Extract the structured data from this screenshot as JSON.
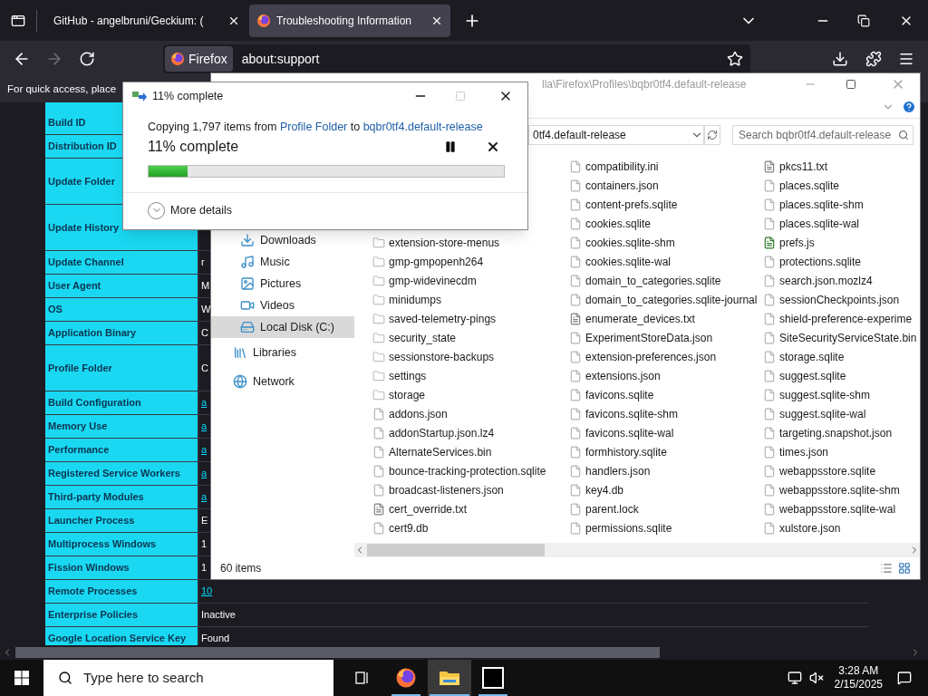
{
  "browser": {
    "tabs": [
      {
        "label": "GitHub - angelbruni/Geckium: (",
        "selected": false
      },
      {
        "label": "Troubleshooting Information",
        "selected": true
      }
    ],
    "identity": "Firefox",
    "url": "about:support",
    "toolbar_hint": "For quick access, place"
  },
  "table": {
    "rows": [
      {
        "label": "Build ID"
      },
      {
        "label": "Distribution ID"
      },
      {
        "label": "Update Folder",
        "tall": true
      },
      {
        "label": "Update History",
        "tall": true
      },
      {
        "label": "Update Channel",
        "value": "r",
        "link": false
      },
      {
        "label": "User Agent",
        "value": "M",
        "link": false
      },
      {
        "label": "OS",
        "value": "W",
        "link": false
      },
      {
        "label": "Application Binary",
        "value": "C",
        "link": false
      },
      {
        "label": "Profile Folder",
        "tall": true,
        "value": "C",
        "link": false
      },
      {
        "label": "Build Configuration",
        "value": "a",
        "link": true
      },
      {
        "label": "Memory Use",
        "value": "a",
        "link": true
      },
      {
        "label": "Performance",
        "value": "a",
        "link": true
      },
      {
        "label": "Registered Service Workers",
        "value": "a",
        "link": true
      },
      {
        "label": "Third-party Modules",
        "value": "a",
        "link": true
      },
      {
        "label": "Launcher Process",
        "value": "E",
        "link": false
      },
      {
        "label": "Multiprocess Windows",
        "value": "1",
        "link": false
      },
      {
        "label": "Fission Windows",
        "value": "1",
        "link": false
      },
      {
        "label": "Remote Processes",
        "value": "10",
        "link": true
      },
      {
        "label": "Enterprise Policies",
        "value": "Inactive",
        "link": false
      },
      {
        "label": "Google Location Service Key",
        "value": "Found",
        "link": false
      }
    ]
  },
  "explorer": {
    "title_path": "lla\\Firefox\\Profiles\\bqbr0tf4.default-release",
    "address": "0tf4.default-release",
    "search": {
      "placeholder": "Search bqbr0tf4.default-release"
    },
    "nav": [
      {
        "label": "Downloads",
        "kind": "downloads",
        "selected": false
      },
      {
        "label": "Music",
        "kind": "music",
        "selected": false
      },
      {
        "label": "Pictures",
        "kind": "pictures",
        "selected": false
      },
      {
        "label": "Videos",
        "kind": "videos",
        "selected": false
      },
      {
        "label": "Local Disk (C:)",
        "kind": "disk",
        "selected": true
      },
      {
        "label": "Libraries",
        "kind": "libraries",
        "selected": false
      },
      {
        "label": "Network",
        "kind": "network",
        "selected": false
      }
    ],
    "columns": [
      [
        {
          "name": "extension-store-menus",
          "kind": "folder"
        },
        {
          "name": "gmp-gmpopenh264",
          "kind": "folder"
        },
        {
          "name": "gmp-widevinecdm",
          "kind": "folder"
        },
        {
          "name": "minidumps",
          "kind": "folder"
        },
        {
          "name": "saved-telemetry-pings",
          "kind": "folder"
        },
        {
          "name": "security_state",
          "kind": "folder"
        },
        {
          "name": "sessionstore-backups",
          "kind": "folder"
        },
        {
          "name": "settings",
          "kind": "folder"
        },
        {
          "name": "storage",
          "kind": "folder"
        },
        {
          "name": "addons.json",
          "kind": "file"
        },
        {
          "name": "addonStartup.json.lz4",
          "kind": "file"
        },
        {
          "name": "AlternateServices.bin",
          "kind": "file"
        },
        {
          "name": "bounce-tracking-protection.sqlite",
          "kind": "file"
        },
        {
          "name": "broadcast-listeners.json",
          "kind": "file"
        },
        {
          "name": "cert_override.txt",
          "kind": "text"
        },
        {
          "name": "cert9.db",
          "kind": "file"
        }
      ],
      [
        {
          "name": "compatibility.ini",
          "kind": "file"
        },
        {
          "name": "containers.json",
          "kind": "file"
        },
        {
          "name": "content-prefs.sqlite",
          "kind": "file"
        },
        {
          "name": "cookies.sqlite",
          "kind": "file"
        },
        {
          "name": "cookies.sqlite-shm",
          "kind": "file"
        },
        {
          "name": "cookies.sqlite-wal",
          "kind": "file"
        },
        {
          "name": "domain_to_categories.sqlite",
          "kind": "file"
        },
        {
          "name": "domain_to_categories.sqlite-journal",
          "kind": "file"
        },
        {
          "name": "enumerate_devices.txt",
          "kind": "text"
        },
        {
          "name": "ExperimentStoreData.json",
          "kind": "file"
        },
        {
          "name": "extension-preferences.json",
          "kind": "file"
        },
        {
          "name": "extensions.json",
          "kind": "file"
        },
        {
          "name": "favicons.sqlite",
          "kind": "file"
        },
        {
          "name": "favicons.sqlite-shm",
          "kind": "file"
        },
        {
          "name": "favicons.sqlite-wal",
          "kind": "file"
        },
        {
          "name": "formhistory.sqlite",
          "kind": "file"
        },
        {
          "name": "handlers.json",
          "kind": "file"
        },
        {
          "name": "key4.db",
          "kind": "file"
        },
        {
          "name": "parent.lock",
          "kind": "file"
        },
        {
          "name": "permissions.sqlite",
          "kind": "file"
        }
      ],
      [
        {
          "name": "pkcs11.txt",
          "kind": "text"
        },
        {
          "name": "places.sqlite",
          "kind": "file"
        },
        {
          "name": "places.sqlite-shm",
          "kind": "file"
        },
        {
          "name": "places.sqlite-wal",
          "kind": "file"
        },
        {
          "name": "prefs.js",
          "kind": "script"
        },
        {
          "name": "protections.sqlite",
          "kind": "file"
        },
        {
          "name": "search.json.mozlz4",
          "kind": "file"
        },
        {
          "name": "sessionCheckpoints.json",
          "kind": "file"
        },
        {
          "name": "shield-preference-experime",
          "kind": "file"
        },
        {
          "name": "SiteSecurityServiceState.bin",
          "kind": "file"
        },
        {
          "name": "storage.sqlite",
          "kind": "file"
        },
        {
          "name": "suggest.sqlite",
          "kind": "file"
        },
        {
          "name": "suggest.sqlite-shm",
          "kind": "file"
        },
        {
          "name": "suggest.sqlite-wal",
          "kind": "file"
        },
        {
          "name": "targeting.snapshot.json",
          "kind": "file"
        },
        {
          "name": "times.json",
          "kind": "file"
        },
        {
          "name": "webappsstore.sqlite",
          "kind": "file"
        },
        {
          "name": "webappsstore.sqlite-shm",
          "kind": "file"
        },
        {
          "name": "webappsstore.sqlite-wal",
          "kind": "file"
        },
        {
          "name": "xulstore.json",
          "kind": "file"
        }
      ]
    ],
    "status": "60 items"
  },
  "dialog": {
    "title": "11% complete",
    "message": [
      {
        "text": "Copying 1,797 items from ",
        "kind": "text"
      },
      {
        "text": "Profile Folder",
        "kind": "link"
      },
      {
        "text": " to ",
        "kind": "text"
      },
      {
        "text": "bqbr0tf4.default-release",
        "kind": "link"
      }
    ],
    "heading": "11% complete",
    "level": 0.11,
    "more_details": "More details"
  },
  "taskbar": {
    "search": {
      "placeholder": "Type here to search"
    },
    "apps": [
      {
        "kind": "taskview",
        "running": false,
        "active": false
      },
      {
        "kind": "firefox",
        "running": true,
        "active": false
      },
      {
        "kind": "explorer",
        "running": true,
        "active": true
      },
      {
        "kind": "sevenzip",
        "running": true,
        "active": false
      }
    ],
    "time": "3:28 AM",
    "date": "2/15/2025"
  }
}
